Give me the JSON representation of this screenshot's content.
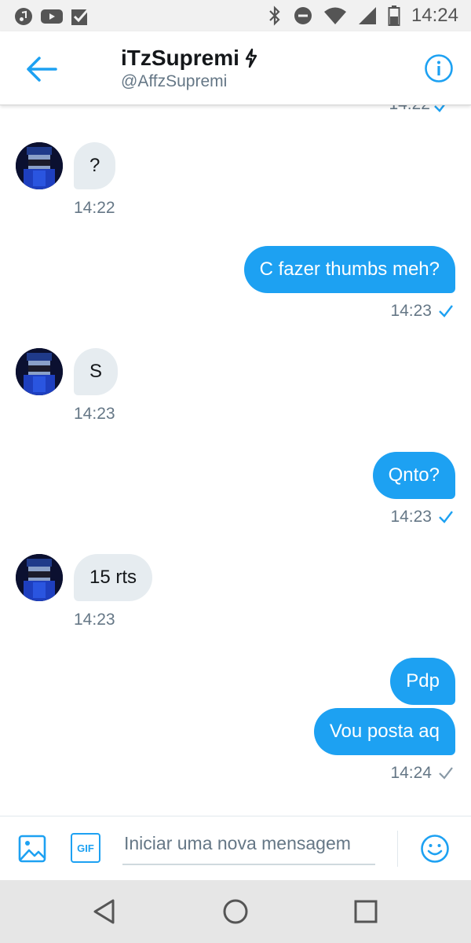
{
  "status_bar": {
    "time": "14:24",
    "left_icons": [
      "music-note-icon",
      "youtube-icon",
      "checkbox-icon"
    ],
    "right_icons": [
      "bluetooth-icon",
      "do-not-disturb-icon",
      "wifi-icon",
      "cell-signal-icon",
      "battery-icon"
    ]
  },
  "header": {
    "name": "iTzSupremi",
    "name_suffix_icon": "lightning-icon",
    "handle": "@AffzSupremi"
  },
  "messages": [
    {
      "direction": "out",
      "text": "",
      "time": "14:22",
      "status": "read"
    },
    {
      "direction": "in",
      "text": "?",
      "time": "14:22"
    },
    {
      "direction": "out",
      "text": "C fazer thumbs meh?",
      "time": "14:23",
      "status": "read"
    },
    {
      "direction": "in",
      "text": "S",
      "time": "14:23"
    },
    {
      "direction": "out",
      "text": "Qnto?",
      "time": "14:23",
      "status": "read"
    },
    {
      "direction": "in",
      "text": "15 rts",
      "time": "14:23"
    },
    {
      "direction": "out",
      "text": "Pdp",
      "time": "",
      "status": ""
    },
    {
      "direction": "out",
      "text": "Vou posta aq",
      "time": "14:24",
      "status": "sent"
    }
  ],
  "composer": {
    "placeholder": "Iniciar uma nova mensagem",
    "gif_label": "GIF"
  },
  "colors": {
    "accent": "#1da1f2",
    "incoming_bubble": "#e6ecf0",
    "muted_text": "#657786"
  }
}
